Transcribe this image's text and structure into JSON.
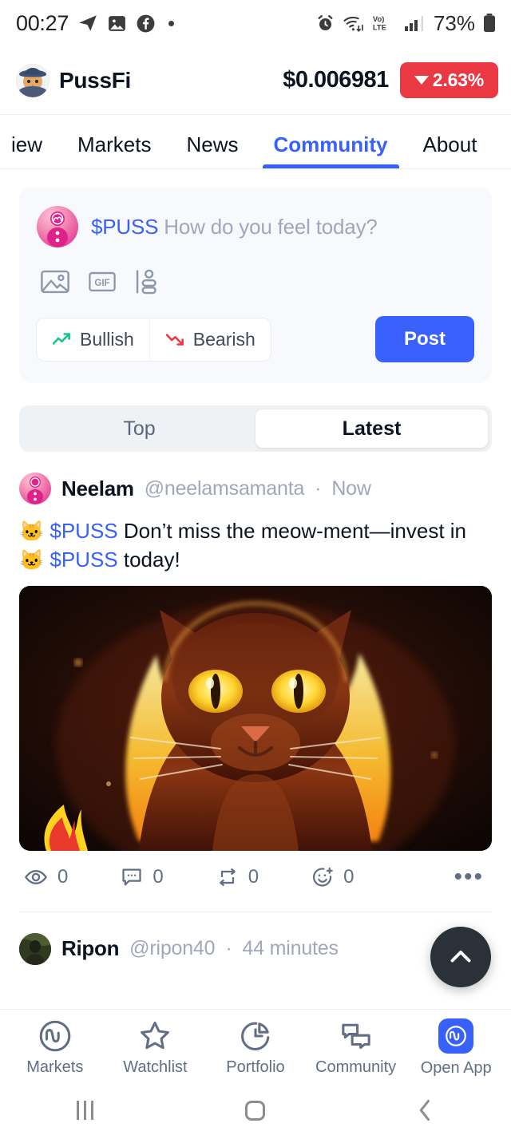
{
  "status_bar": {
    "time": "00:27",
    "battery_percent": "73%",
    "network_label": "LTE",
    "volte_label": "Vo)",
    "left_icons": [
      "telegram-icon",
      "gallery-icon",
      "facebook-icon",
      "dot-icon"
    ],
    "right_icons": [
      "alarm-icon",
      "wifi-icon",
      "volte-icon",
      "signal-icon",
      "battery-icon"
    ]
  },
  "coin_header": {
    "logo_icon": "cat-with-hat-logo",
    "name": "PussFi",
    "price": "$0.006981",
    "change": "2.63%",
    "change_direction": "down",
    "change_color": "#EA3943"
  },
  "tabs": {
    "items": [
      {
        "label": "iew",
        "active": false
      },
      {
        "label": "Markets",
        "active": false
      },
      {
        "label": "News",
        "active": false
      },
      {
        "label": "Community",
        "active": true
      },
      {
        "label": "About",
        "active": false
      }
    ],
    "active_color": "#3861FB"
  },
  "composer": {
    "avatar_icon": "cmc-user-avatar",
    "ticker": "$PUSS",
    "placeholder": "How do you feel today?",
    "media_icons": [
      "image-icon",
      "gif-icon",
      "poll-icon"
    ],
    "gif_label": "GIF",
    "bullish_label": "Bullish",
    "bearish_label": "Bearish",
    "post_label": "Post",
    "post_button_color": "#3861FB",
    "bullish_color": "#16C784",
    "bearish_color": "#EA3943"
  },
  "sort_toggle": {
    "options": [
      {
        "label": "Top",
        "active": false
      },
      {
        "label": "Latest",
        "active": true
      }
    ]
  },
  "feed": [
    {
      "avatar_icon": "cmc-user-avatar",
      "name": "Neelam",
      "handle": "@neelamsamanta",
      "separator": "·",
      "time": "Now",
      "body_line1_ticker": "$PUSS",
      "body_line1_text": "Don’t miss the meow-ment—invest in",
      "body_line2_ticker": "$PUSS",
      "body_line2_text": "today!",
      "emoji": "🐱",
      "image_alt": "fiery-cat-artwork",
      "engagement": [
        {
          "icon": "eye-icon",
          "count": "0"
        },
        {
          "icon": "comment-icon",
          "count": "0"
        },
        {
          "icon": "repost-icon",
          "count": "0"
        },
        {
          "icon": "reaction-icon",
          "count": "0"
        }
      ],
      "more_label": "•••"
    },
    {
      "avatar_icon": "ripon-avatar",
      "name": "Ripon",
      "handle": "@ripon40",
      "separator": "·",
      "time": "44 minutes"
    }
  ],
  "fab": {
    "icon": "chevron-up-icon",
    "background": "#2B3139"
  },
  "bottom_nav": {
    "items": [
      {
        "label": "Markets",
        "icon": "cmc-markets-icon",
        "active": false
      },
      {
        "label": "Watchlist",
        "icon": "star-icon",
        "active": false
      },
      {
        "label": "Portfolio",
        "icon": "pie-chart-icon",
        "active": false
      },
      {
        "label": "Community",
        "icon": "chat-bubbles-icon",
        "active": false
      },
      {
        "label": "Open App",
        "icon": "cmc-app-icon",
        "active": true
      }
    ]
  },
  "android_nav": {
    "recent_icon": "recent-apps-icon",
    "home_icon": "home-icon",
    "back_icon": "back-icon"
  }
}
